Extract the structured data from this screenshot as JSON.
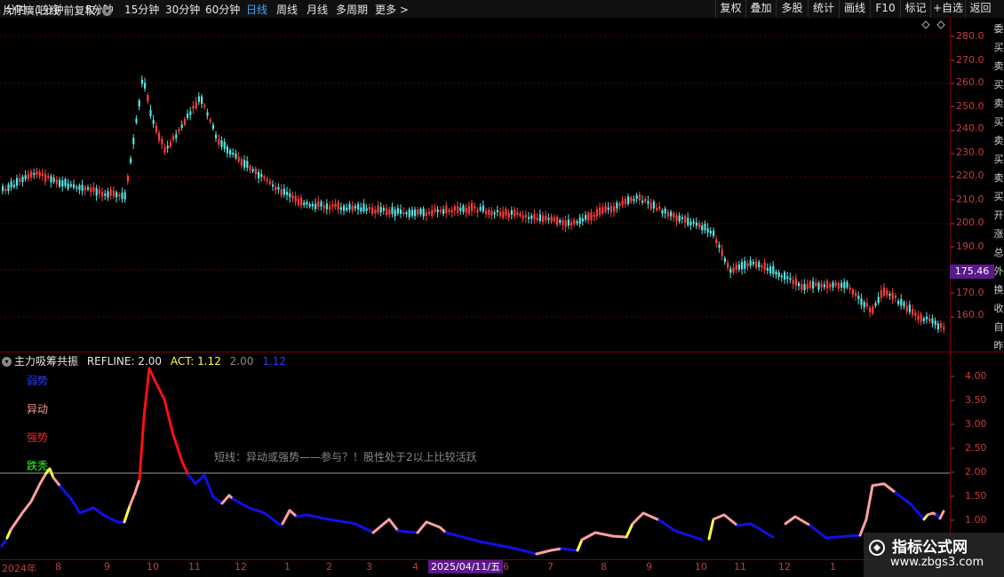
{
  "toolbar": {
    "periods": [
      "分时",
      "1分钟",
      "5分钟",
      "15分钟",
      "30分钟",
      "60分钟",
      "日线",
      "周线",
      "月线",
      "多周期",
      "更多 >"
    ],
    "active_period": "日线",
    "tools": [
      "复权",
      "叠加",
      "多股",
      "统计",
      "画线",
      "F10",
      "标记",
      "+自选",
      "返回"
    ]
  },
  "price_panel": {
    "title": "片仔癀(日线 前复权)",
    "y_ticks": [
      "280.0",
      "270.0",
      "260.0",
      "250.0",
      "240.0",
      "230.0",
      "220.0",
      "210.0",
      "200.0",
      "190.0",
      "170.0",
      "160.0"
    ],
    "last_price": "175.46"
  },
  "indicator_panel": {
    "name": "主力吸筹共振",
    "refline_label": "REFLINE: 2.00",
    "act_label": "ACT: 1.12",
    "extra_value_1": "2.00",
    "extra_value_2": "1.12",
    "y_ticks": [
      "4.00",
      "3.50",
      "3.00",
      "2.50",
      "2.00",
      "1.50",
      "1.00"
    ],
    "levels": [
      {
        "text": "弱势",
        "color": "#2a3cff"
      },
      {
        "text": "异动",
        "color": "#ff9a9a"
      },
      {
        "text": "强势",
        "color": "#ff2020"
      },
      {
        "text": "跌秃",
        "color": "#30ff30"
      }
    ],
    "note": "短线：异动或强势——参与？！股性处于2以上比较活跃"
  },
  "time_axis": {
    "labels": [
      "2024年",
      "8",
      "9",
      "10",
      "11",
      "12",
      "1",
      "2",
      "3",
      "4",
      "6",
      "7",
      "8",
      "9",
      "10",
      "11",
      "12",
      "1"
    ],
    "cursor_date": "2025/04/11/五"
  },
  "right_strip": {
    "chars": [
      "委",
      "买",
      "卖",
      "买",
      "卖",
      "买",
      "卖",
      "买",
      "卖",
      "买",
      "开",
      "涨",
      "总",
      "外",
      "换",
      "收",
      "自",
      "昨"
    ]
  },
  "watermark": {
    "title": "指标公式网",
    "url": "www.zbgs3.com"
  },
  "colors": {
    "up_candle": "#ff3c3c",
    "down_candle": "#55e6e6",
    "weak": "#1010e6",
    "abnormal": "#ffa0a0",
    "strong": "#ff1010",
    "transition": "#ffff40",
    "refline": "#9a9a9a",
    "axis": "#c43c3c"
  }
}
